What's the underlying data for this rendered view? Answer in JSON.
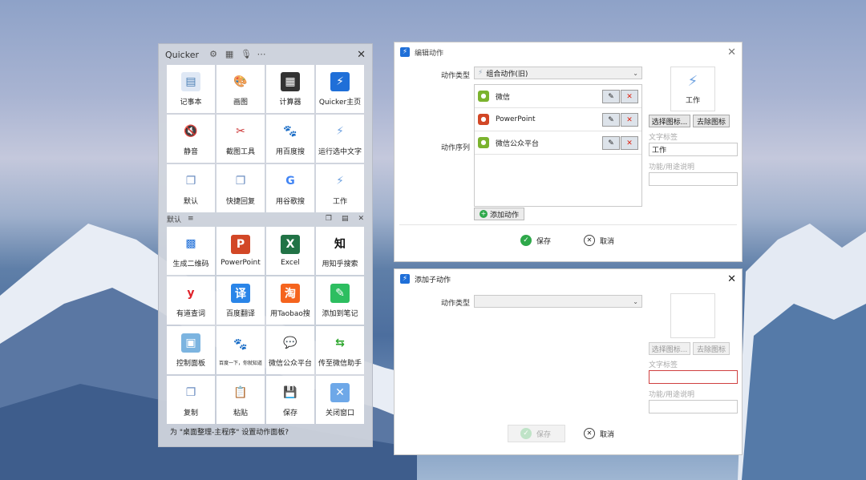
{
  "quicker": {
    "title": "Quicker",
    "close": "✕",
    "grid_top": [
      {
        "label": "记事本",
        "icon": "notepad-icon",
        "glyph": "▤",
        "bg": "#dfe8f5",
        "fg": "#4a7fb5"
      },
      {
        "label": "画图",
        "icon": "paint-palette-icon",
        "glyph": "🎨",
        "bg": "#fff",
        "fg": "#c48a2a"
      },
      {
        "label": "计算器",
        "icon": "calculator-icon",
        "glyph": "▦",
        "bg": "#333",
        "fg": "#fff"
      },
      {
        "label": "Quicker主页",
        "icon": "quicker-bolt-icon",
        "glyph": "⚡",
        "bg": "#1f6fd8",
        "fg": "#fff"
      },
      {
        "label": "静音",
        "icon": "mute-speaker-icon",
        "glyph": "🔇",
        "bg": "#fff",
        "fg": "#9aa4b2"
      },
      {
        "label": "截图工具",
        "icon": "scissors-icon",
        "glyph": "✂",
        "bg": "#fff",
        "fg": "#c33"
      },
      {
        "label": "用百度搜",
        "icon": "baidu-paw-icon",
        "glyph": "🐾",
        "bg": "#fff",
        "fg": "#2a60d8"
      },
      {
        "label": "运行选中文字",
        "icon": "bolt-outline-icon",
        "glyph": "⚡",
        "bg": "#fff",
        "fg": "#6fa2e0"
      },
      {
        "label": "默认",
        "icon": "window-stack-icon",
        "glyph": "❐",
        "bg": "#fff",
        "fg": "#6a8cc0"
      },
      {
        "label": "快捷回复",
        "icon": "window-stack-icon",
        "glyph": "❐",
        "bg": "#fff",
        "fg": "#6a8cc0"
      },
      {
        "label": "用谷歌搜",
        "icon": "google-g-icon",
        "glyph": "G",
        "bg": "#fff",
        "fg": "#4285f4"
      },
      {
        "label": "工作",
        "icon": "bolt-outline-icon",
        "glyph": "⚡",
        "bg": "#fff",
        "fg": "#6fa2e0"
      }
    ],
    "section_label": "默认",
    "section_menu": "≡",
    "grid_bottom": [
      {
        "label": "生成二维码",
        "icon": "qr-code-icon",
        "glyph": "▩",
        "bg": "#fff",
        "fg": "#1f6fd8"
      },
      {
        "label": "PowerPoint",
        "icon": "powerpoint-icon",
        "glyph": "P",
        "bg": "#d24726",
        "fg": "#fff"
      },
      {
        "label": "Excel",
        "icon": "excel-icon",
        "glyph": "X",
        "bg": "#217346",
        "fg": "#fff"
      },
      {
        "label": "用知乎搜索",
        "icon": "zhihu-icon",
        "glyph": "知",
        "bg": "#fff",
        "fg": "#111"
      },
      {
        "label": "有道查词",
        "icon": "youdao-icon",
        "glyph": "y",
        "bg": "#fff",
        "fg": "#e0222a"
      },
      {
        "label": "百度翻译",
        "icon": "baidu-translate-icon",
        "glyph": "译",
        "bg": "#2a85e8",
        "fg": "#fff"
      },
      {
        "label": "用Taobao搜",
        "icon": "taobao-icon",
        "glyph": "淘",
        "bg": "#f5641e",
        "fg": "#fff"
      },
      {
        "label": "添加到笔记",
        "icon": "evernote-icon",
        "glyph": "✎",
        "bg": "#2dbe60",
        "fg": "#fff"
      },
      {
        "label": "控制面板",
        "icon": "control-panel-icon",
        "glyph": "▣",
        "bg": "#7cb4e0",
        "fg": "#fff"
      },
      {
        "label": "百度一下，你就知道",
        "icon": "baidu-paw-icon",
        "glyph": "🐾",
        "bg": "#fff",
        "fg": "#2a60d8",
        "small": true
      },
      {
        "label": "微信公众平台",
        "icon": "wechat-icon",
        "glyph": "💬",
        "bg": "#fff",
        "fg": "#7bb32e"
      },
      {
        "label": "传至微信助手",
        "icon": "wechat-transfer-icon",
        "glyph": "⇆",
        "bg": "#fff",
        "fg": "#2aa52a"
      },
      {
        "label": "复制",
        "icon": "copy-icon",
        "glyph": "❐",
        "bg": "#fff",
        "fg": "#6a8cc0"
      },
      {
        "label": "粘贴",
        "icon": "paste-icon",
        "glyph": "📋",
        "bg": "#fff",
        "fg": "#6a8cc0"
      },
      {
        "label": "保存",
        "icon": "save-floppy-icon",
        "glyph": "💾",
        "bg": "#fff",
        "fg": "#6a8cc0"
      },
      {
        "label": "关闭窗口",
        "icon": "close-window-icon",
        "glyph": "✕",
        "bg": "#6ea8e8",
        "fg": "#fff"
      }
    ],
    "footer": "为 \"桌面整理-主程序\" 设置动作面板?"
  },
  "edit_dialog": {
    "title": "编辑动作",
    "type_label": "动作类型",
    "type_value": "组合动作(旧)",
    "seq_label": "动作序列",
    "actions": [
      {
        "label": "微信",
        "icon": "wechat-icon",
        "color": "#7bb32e"
      },
      {
        "label": "PowerPoint",
        "icon": "powerpoint-icon",
        "color": "#d24726"
      },
      {
        "label": "微信公众平台",
        "icon": "wechat-icon",
        "color": "#7bb32e"
      }
    ],
    "add_action": "添加动作",
    "icon_caption": "工作",
    "choose_icon": "选择图标...",
    "remove_icon": "去除图标",
    "text_label": "文字标签",
    "text_value": "工作",
    "desc_label": "功能/用途说明",
    "desc_value": "",
    "save": "保存",
    "cancel": "取消"
  },
  "sub_dialog": {
    "title": "添加子动作",
    "type_label": "动作类型",
    "type_value": "",
    "choose_icon": "选择图标...",
    "remove_icon": "去除图标",
    "text_label": "文字标签",
    "text_value": "",
    "desc_label": "功能/用途说明",
    "desc_value": "",
    "save": "保存",
    "cancel": "取消"
  }
}
